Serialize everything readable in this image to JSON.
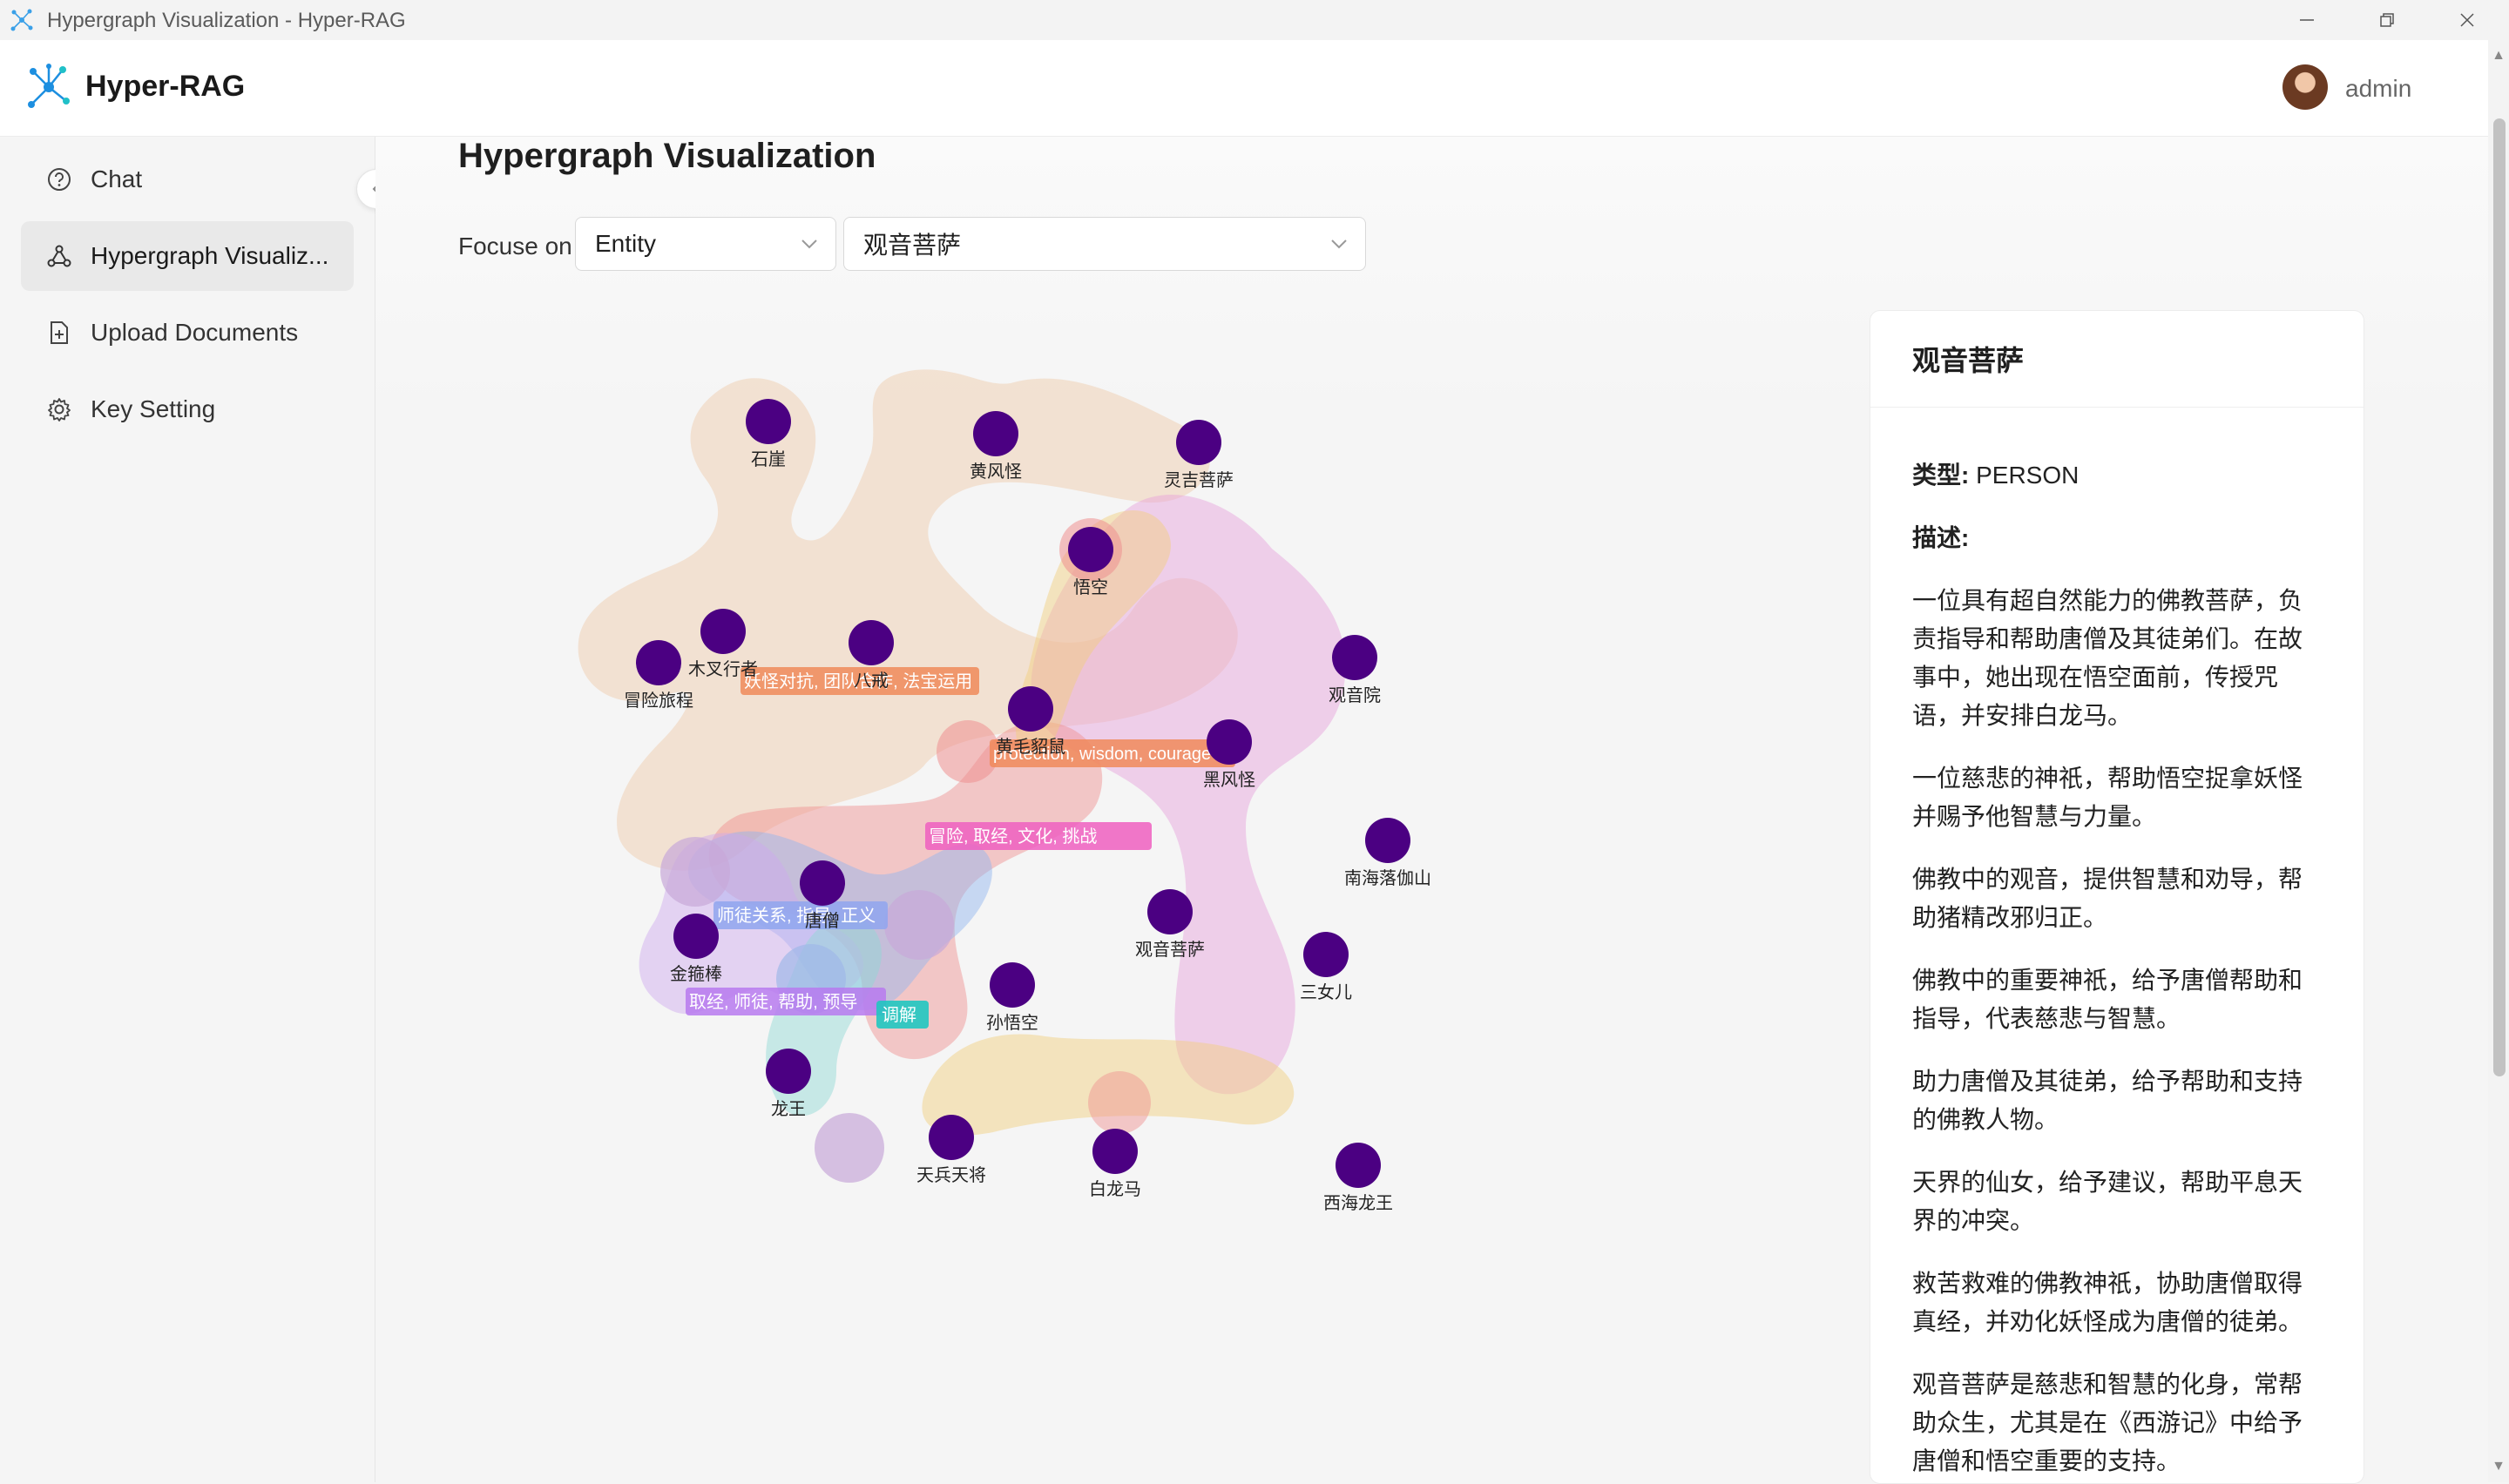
{
  "window": {
    "title": "Hypergraph Visualization - Hyper-RAG"
  },
  "header": {
    "brand": "Hyper-RAG",
    "username": "admin"
  },
  "sidebar": {
    "items": [
      {
        "label": "Chat",
        "icon": "help-circle-icon",
        "active": false
      },
      {
        "label": "Hypergraph Visualiz...",
        "icon": "graph-nodes-icon",
        "active": true
      },
      {
        "label": "Upload Documents",
        "icon": "file-add-icon",
        "active": false
      },
      {
        "label": "Key Setting",
        "icon": "gear-icon",
        "active": false
      }
    ]
  },
  "main": {
    "title": "Hypergraph Visualization",
    "focus_label": "Focuse on",
    "type_select": "Entity",
    "entity_select": "观音菩萨"
  },
  "graph": {
    "nodes": [
      "石崖",
      "黄风怪",
      "灵吉菩萨",
      "悟空",
      "观音院",
      "木叉行者",
      "八戒",
      "冒险旅程",
      "黄毛貂鼠",
      "黑风怪",
      "南海落伽山",
      "唐僧",
      "观音菩萨",
      "三女儿",
      "金箍棒",
      "孙悟空",
      "龙王",
      "天兵天将",
      "白龙马",
      "西海龙王"
    ],
    "edge_labels": [
      "妖怪对抗, 团队合作, 法宝运用",
      "protection, wisdom, courage",
      "冒险, 取经, 文化, 挑战",
      "师徒关系, 指导, 正义",
      "取经, 师徒, 帮助, 预导",
      "调解"
    ],
    "colors": {
      "node": "#4b0082",
      "peach": "#f0c9a8",
      "pink": "#e6a0dc",
      "red": "#ef8f8f",
      "blue": "#8fb4ef",
      "purple": "#cfa8ef",
      "teal": "#8fd9d4",
      "yellow": "#f2cf7a"
    }
  },
  "detail": {
    "title": "观音菩萨",
    "type_key": "类型:",
    "type_value": "PERSON",
    "desc_key": "描述:",
    "paragraphs": [
      "一位具有超自然能力的佛教菩萨，负责指导和帮助唐僧及其徒弟们。在故事中，她出现在悟空面前，传授咒语，并安排白龙马。",
      "一位慈悲的神祇，帮助悟空捉拿妖怪并赐予他智慧与力量。",
      "佛教中的观音，提供智慧和劝导，帮助猪精改邪归正。",
      "佛教中的重要神祇，给予唐僧帮助和指导，代表慈悲与智慧。",
      "助力唐僧及其徒弟，给予帮助和支持的佛教人物。",
      "天界的仙女，给予建议，帮助平息天界的冲突。",
      "救苦救难的佛教神祇，协助唐僧取得真经，并劝化妖怪成为唐僧的徒弟。",
      "观音菩萨是慈悲和智慧的化身，常帮助众生，尤其是在《西游记》中给予唐僧和悟空重要的支持。"
    ]
  }
}
